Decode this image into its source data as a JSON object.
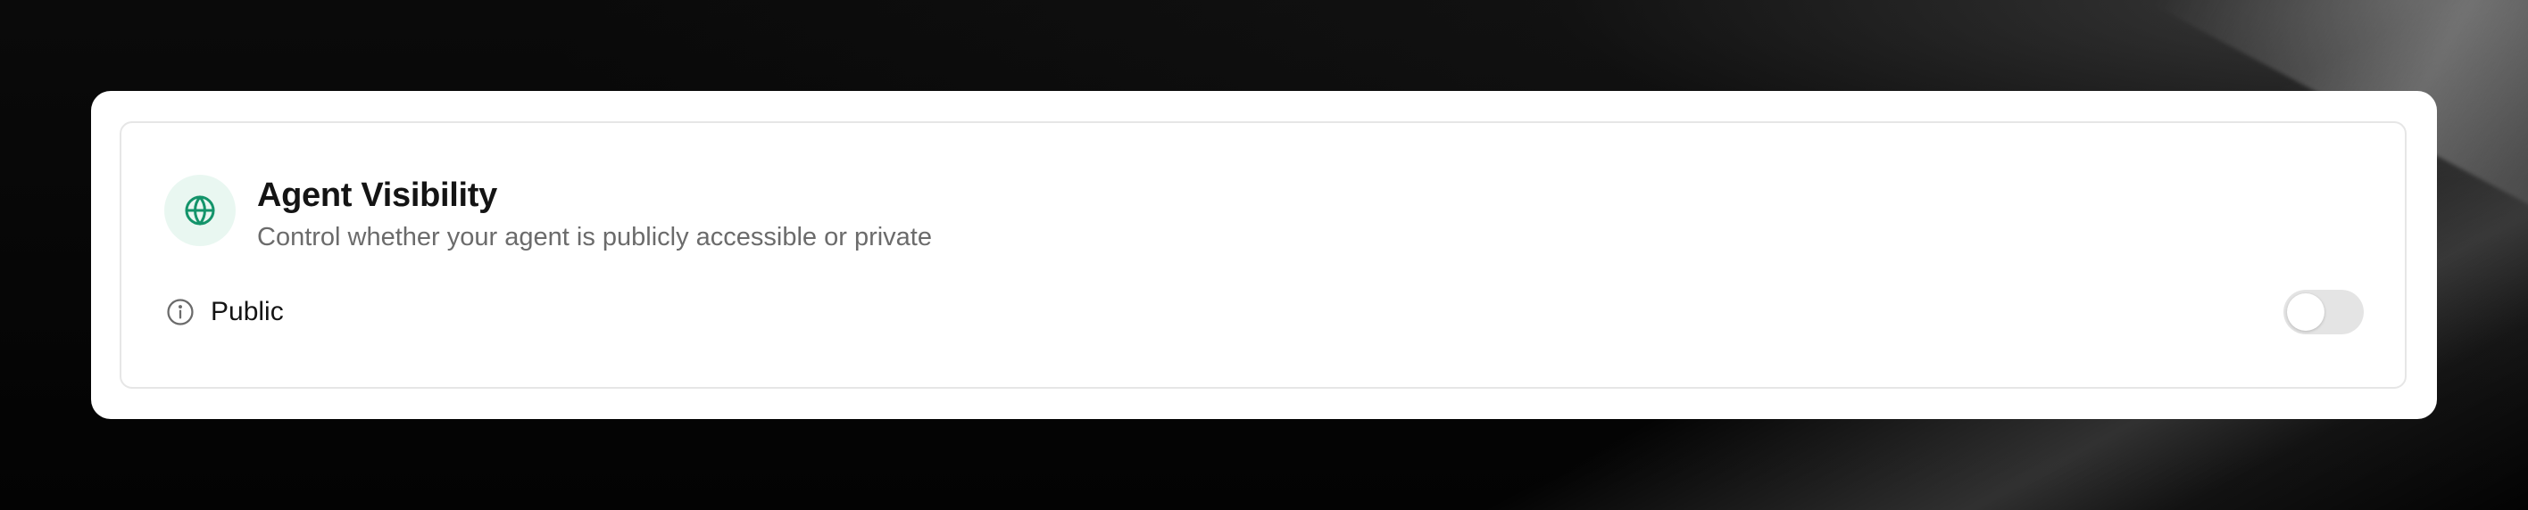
{
  "settings_card": {
    "title": "Agent Visibility",
    "subtitle": "Control whether your agent is publicly accessible or private",
    "header_icon": "globe-icon",
    "accent_color": "#13946a",
    "accent_bg": "#e9f7f1"
  },
  "visibility_row": {
    "label": "Public",
    "info_icon": "info-icon",
    "toggle_on": false
  }
}
